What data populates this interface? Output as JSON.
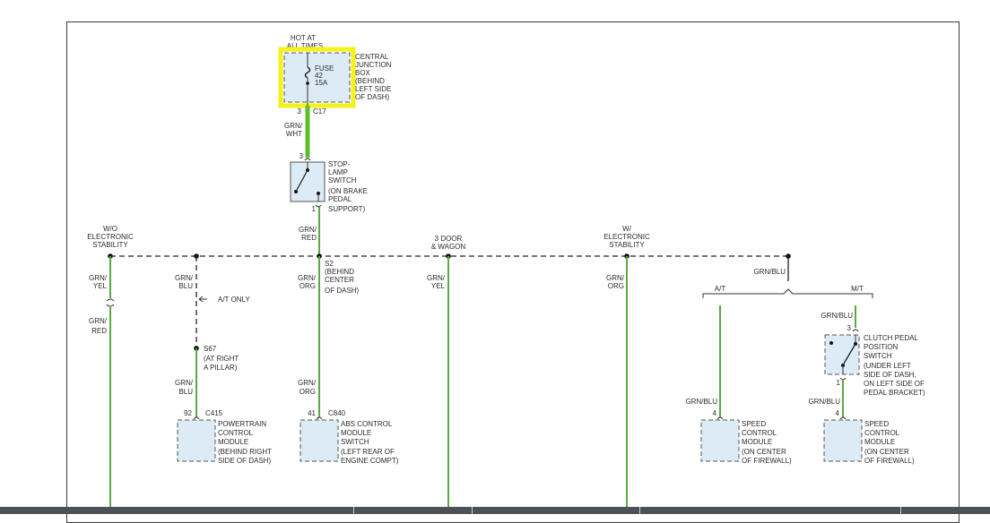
{
  "power": {
    "line1": "HOT AT",
    "line2": "ALL TIMES"
  },
  "fuse": {
    "l1": "FUSE",
    "l2": "42",
    "l3": "15A"
  },
  "cjb": [
    "CENTRAL",
    "JUNCTION",
    "BOX",
    "(BEHIND",
    "LEFT SIDE",
    "OF DASH)"
  ],
  "c17": {
    "pin": "3",
    "name": "C17"
  },
  "grnwht": {
    "l1": "GRN/",
    "l2": "WHT"
  },
  "stoplamp": {
    "pin_top": "3",
    "pin_bot": "1",
    "label": [
      "STOP-",
      "LAMP",
      "SWITCH",
      "(ON BRAKE",
      "PEDAL",
      "SUPPORT)"
    ]
  },
  "grnred": {
    "l1": "GRN/",
    "l2": "RED"
  },
  "branches": {
    "wo_esc": [
      "W/O",
      "ELECTRONIC",
      "STABILITY"
    ],
    "door3": [
      "3 DOOR",
      "& WAGON"
    ],
    "w_esc": [
      "W/",
      "ELECTRONIC",
      "STABILITY"
    ]
  },
  "s2": [
    "S2",
    "(BEHIND",
    "CENTER",
    "OF DASH)"
  ],
  "wires": {
    "w1a": [
      "GRN/",
      "YEL"
    ],
    "w1b": [
      "GRN/",
      "RED"
    ],
    "w2a": [
      "GRN/",
      "BLU"
    ],
    "w2b": [
      "GRN/",
      "BLU"
    ],
    "w3a": [
      "GRN/",
      "ORG"
    ],
    "w3b": [
      "GRN/",
      "ORG"
    ],
    "w4": [
      "GRN/",
      "YEL"
    ],
    "w5": [
      "GRN/",
      "ORG"
    ],
    "w6": "GRN/BLU",
    "w7": "GRN/BLU",
    "w8": "GRN/BLU",
    "w9": "GRN/BLU"
  },
  "at_only": "A/T ONLY",
  "s67": [
    "S67",
    "(AT RIGHT",
    "A PILLAR)"
  ],
  "at": "A/T",
  "mt": "M/T",
  "pcm": {
    "pin": "92",
    "conn": "C415",
    "label": [
      "POWERTRAIN",
      "CONTROL",
      "MODULE",
      "(BEHIND RIGHT",
      "SIDE OF DASH)"
    ]
  },
  "abs": {
    "pin": "41",
    "conn": "C840",
    "label": [
      "ABS CONTROL",
      "MODULE",
      "SWITCH",
      "(LEFT REAR OF",
      "ENGINE COMPT)"
    ]
  },
  "scm1": {
    "pin": "4",
    "label": [
      "SPEED",
      "CONTROL",
      "MODULE",
      "(ON CENTER",
      "OF FIREWALL)"
    ]
  },
  "scm2": {
    "pin": "4",
    "label": [
      "SPEED",
      "CONTROL",
      "MODULE",
      "(ON CENTER",
      "OF FIREWALL)"
    ]
  },
  "clutch": {
    "pin_top": "3",
    "pin_bot": "1",
    "label": [
      "CLUTCH PEDAL",
      "POSITION",
      "SWITCH",
      "(UNDER LEFT",
      "SIDE OF DASH,",
      "ON LEFT SIDE OF",
      "PEDAL BRACKET)"
    ]
  },
  "colors": {
    "wire": "#5aa846",
    "highlight": "#f2f213",
    "component": "#dcebf5"
  }
}
